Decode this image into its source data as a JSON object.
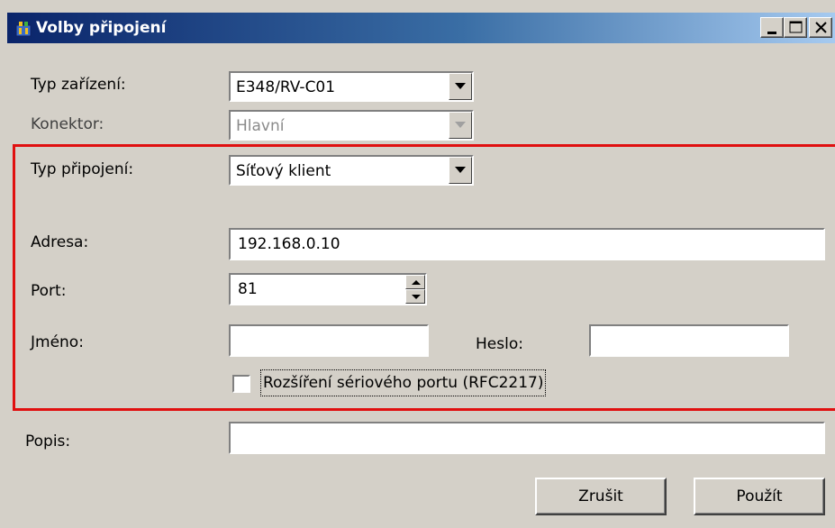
{
  "window": {
    "title": "Volby připojení",
    "controls": {
      "minimize": "minimize-icon",
      "maximize": "maximize-icon",
      "close": "close-icon"
    }
  },
  "form": {
    "device_type": {
      "label": "Typ zařízení:",
      "value": "E348/RV-C01"
    },
    "connector": {
      "label": "Konektor:",
      "value": "Hlavní",
      "disabled": true
    },
    "connection_type": {
      "label": "Typ připojení:",
      "value": "Síťový klient"
    },
    "address": {
      "label": "Adresa:",
      "value": "192.168.0.10"
    },
    "port": {
      "label": "Port:",
      "value": "81"
    },
    "username": {
      "label": "Jméno:",
      "value": ""
    },
    "password": {
      "label": "Heslo:",
      "value": ""
    },
    "rfc2217": {
      "label": "Rozšíření sériového portu (RFC2217)",
      "checked": false
    },
    "description": {
      "label": "Popis:",
      "value": ""
    }
  },
  "buttons": {
    "cancel": "Zrušit",
    "apply": "Použít"
  },
  "colors": {
    "highlight_border": "#e01010",
    "titlebar_start": "#0a246a",
    "titlebar_end": "#a6caf0"
  }
}
